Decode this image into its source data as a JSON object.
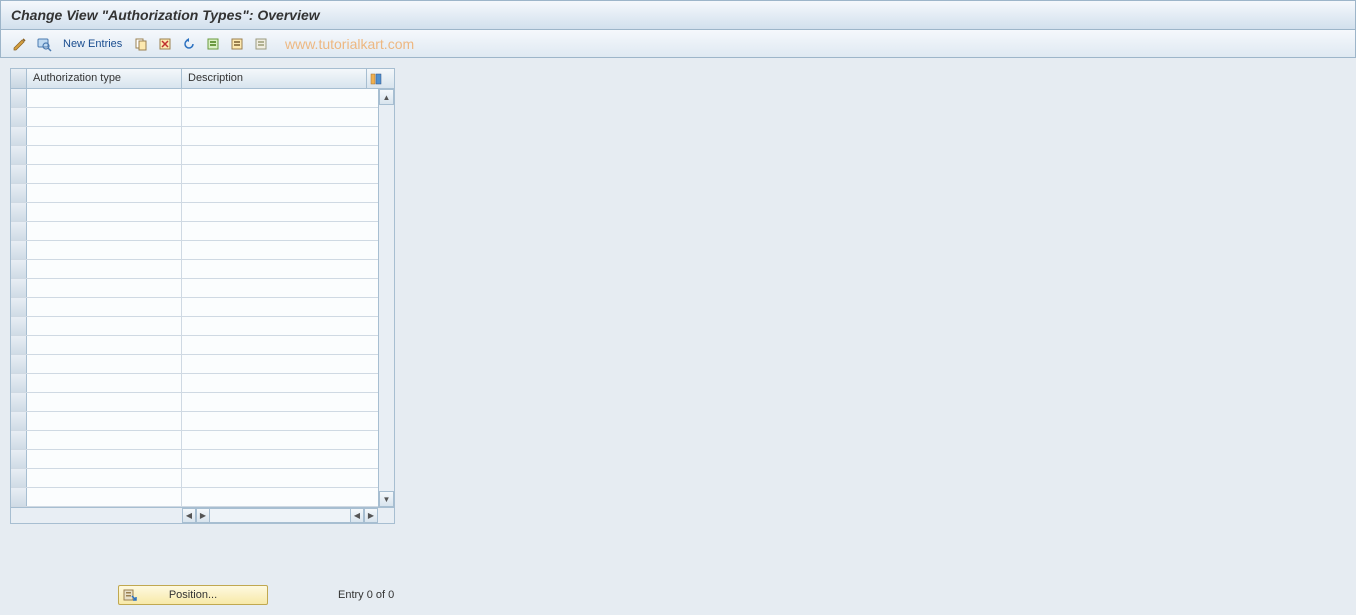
{
  "title": "Change View \"Authorization Types\": Overview",
  "toolbar": {
    "new_entries_label": "New Entries"
  },
  "watermark": "www.tutorialkart.com",
  "table": {
    "columns": {
      "auth_type": "Authorization type",
      "description": "Description"
    },
    "rows": [
      {
        "auth_type": "",
        "description": ""
      },
      {
        "auth_type": "",
        "description": ""
      },
      {
        "auth_type": "",
        "description": ""
      },
      {
        "auth_type": "",
        "description": ""
      },
      {
        "auth_type": "",
        "description": ""
      },
      {
        "auth_type": "",
        "description": ""
      },
      {
        "auth_type": "",
        "description": ""
      },
      {
        "auth_type": "",
        "description": ""
      },
      {
        "auth_type": "",
        "description": ""
      },
      {
        "auth_type": "",
        "description": ""
      },
      {
        "auth_type": "",
        "description": ""
      },
      {
        "auth_type": "",
        "description": ""
      },
      {
        "auth_type": "",
        "description": ""
      },
      {
        "auth_type": "",
        "description": ""
      },
      {
        "auth_type": "",
        "description": ""
      },
      {
        "auth_type": "",
        "description": ""
      },
      {
        "auth_type": "",
        "description": ""
      },
      {
        "auth_type": "",
        "description": ""
      },
      {
        "auth_type": "",
        "description": ""
      },
      {
        "auth_type": "",
        "description": ""
      },
      {
        "auth_type": "",
        "description": ""
      },
      {
        "auth_type": "",
        "description": ""
      }
    ]
  },
  "footer": {
    "position_label": "Position...",
    "entry_status": "Entry 0 of 0"
  }
}
